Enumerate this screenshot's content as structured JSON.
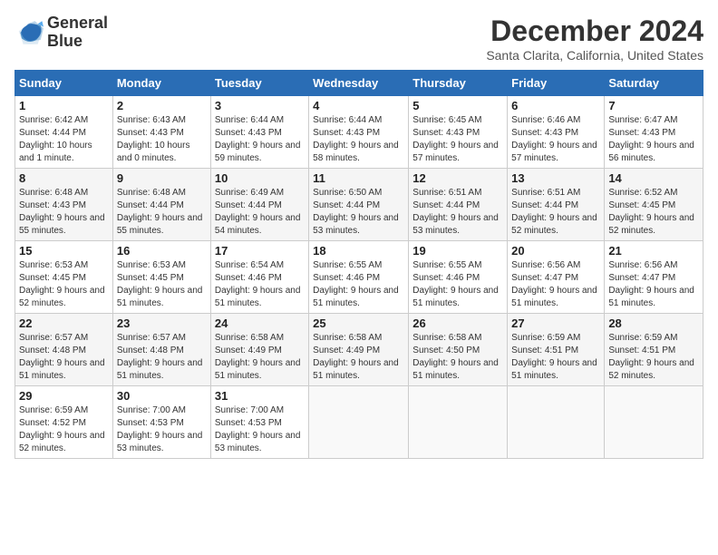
{
  "logo": {
    "line1": "General",
    "line2": "Blue"
  },
  "title": "December 2024",
  "location": "Santa Clarita, California, United States",
  "days_header": [
    "Sunday",
    "Monday",
    "Tuesday",
    "Wednesday",
    "Thursday",
    "Friday",
    "Saturday"
  ],
  "weeks": [
    [
      {
        "day": "1",
        "sun": "Sunrise: 6:42 AM",
        "set": "Sunset: 4:44 PM",
        "day_text": "Daylight: 10 hours and 1 minute."
      },
      {
        "day": "2",
        "sun": "Sunrise: 6:43 AM",
        "set": "Sunset: 4:43 PM",
        "day_text": "Daylight: 10 hours and 0 minutes."
      },
      {
        "day": "3",
        "sun": "Sunrise: 6:44 AM",
        "set": "Sunset: 4:43 PM",
        "day_text": "Daylight: 9 hours and 59 minutes."
      },
      {
        "day": "4",
        "sun": "Sunrise: 6:44 AM",
        "set": "Sunset: 4:43 PM",
        "day_text": "Daylight: 9 hours and 58 minutes."
      },
      {
        "day": "5",
        "sun": "Sunrise: 6:45 AM",
        "set": "Sunset: 4:43 PM",
        "day_text": "Daylight: 9 hours and 57 minutes."
      },
      {
        "day": "6",
        "sun": "Sunrise: 6:46 AM",
        "set": "Sunset: 4:43 PM",
        "day_text": "Daylight: 9 hours and 57 minutes."
      },
      {
        "day": "7",
        "sun": "Sunrise: 6:47 AM",
        "set": "Sunset: 4:43 PM",
        "day_text": "Daylight: 9 hours and 56 minutes."
      }
    ],
    [
      {
        "day": "8",
        "sun": "Sunrise: 6:48 AM",
        "set": "Sunset: 4:43 PM",
        "day_text": "Daylight: 9 hours and 55 minutes."
      },
      {
        "day": "9",
        "sun": "Sunrise: 6:48 AM",
        "set": "Sunset: 4:44 PM",
        "day_text": "Daylight: 9 hours and 55 minutes."
      },
      {
        "day": "10",
        "sun": "Sunrise: 6:49 AM",
        "set": "Sunset: 4:44 PM",
        "day_text": "Daylight: 9 hours and 54 minutes."
      },
      {
        "day": "11",
        "sun": "Sunrise: 6:50 AM",
        "set": "Sunset: 4:44 PM",
        "day_text": "Daylight: 9 hours and 53 minutes."
      },
      {
        "day": "12",
        "sun": "Sunrise: 6:51 AM",
        "set": "Sunset: 4:44 PM",
        "day_text": "Daylight: 9 hours and 53 minutes."
      },
      {
        "day": "13",
        "sun": "Sunrise: 6:51 AM",
        "set": "Sunset: 4:44 PM",
        "day_text": "Daylight: 9 hours and 52 minutes."
      },
      {
        "day": "14",
        "sun": "Sunrise: 6:52 AM",
        "set": "Sunset: 4:45 PM",
        "day_text": "Daylight: 9 hours and 52 minutes."
      }
    ],
    [
      {
        "day": "15",
        "sun": "Sunrise: 6:53 AM",
        "set": "Sunset: 4:45 PM",
        "day_text": "Daylight: 9 hours and 52 minutes."
      },
      {
        "day": "16",
        "sun": "Sunrise: 6:53 AM",
        "set": "Sunset: 4:45 PM",
        "day_text": "Daylight: 9 hours and 51 minutes."
      },
      {
        "day": "17",
        "sun": "Sunrise: 6:54 AM",
        "set": "Sunset: 4:46 PM",
        "day_text": "Daylight: 9 hours and 51 minutes."
      },
      {
        "day": "18",
        "sun": "Sunrise: 6:55 AM",
        "set": "Sunset: 4:46 PM",
        "day_text": "Daylight: 9 hours and 51 minutes."
      },
      {
        "day": "19",
        "sun": "Sunrise: 6:55 AM",
        "set": "Sunset: 4:46 PM",
        "day_text": "Daylight: 9 hours and 51 minutes."
      },
      {
        "day": "20",
        "sun": "Sunrise: 6:56 AM",
        "set": "Sunset: 4:47 PM",
        "day_text": "Daylight: 9 hours and 51 minutes."
      },
      {
        "day": "21",
        "sun": "Sunrise: 6:56 AM",
        "set": "Sunset: 4:47 PM",
        "day_text": "Daylight: 9 hours and 51 minutes."
      }
    ],
    [
      {
        "day": "22",
        "sun": "Sunrise: 6:57 AM",
        "set": "Sunset: 4:48 PM",
        "day_text": "Daylight: 9 hours and 51 minutes."
      },
      {
        "day": "23",
        "sun": "Sunrise: 6:57 AM",
        "set": "Sunset: 4:48 PM",
        "day_text": "Daylight: 9 hours and 51 minutes."
      },
      {
        "day": "24",
        "sun": "Sunrise: 6:58 AM",
        "set": "Sunset: 4:49 PM",
        "day_text": "Daylight: 9 hours and 51 minutes."
      },
      {
        "day": "25",
        "sun": "Sunrise: 6:58 AM",
        "set": "Sunset: 4:49 PM",
        "day_text": "Daylight: 9 hours and 51 minutes."
      },
      {
        "day": "26",
        "sun": "Sunrise: 6:58 AM",
        "set": "Sunset: 4:50 PM",
        "day_text": "Daylight: 9 hours and 51 minutes."
      },
      {
        "day": "27",
        "sun": "Sunrise: 6:59 AM",
        "set": "Sunset: 4:51 PM",
        "day_text": "Daylight: 9 hours and 51 minutes."
      },
      {
        "day": "28",
        "sun": "Sunrise: 6:59 AM",
        "set": "Sunset: 4:51 PM",
        "day_text": "Daylight: 9 hours and 52 minutes."
      }
    ],
    [
      {
        "day": "29",
        "sun": "Sunrise: 6:59 AM",
        "set": "Sunset: 4:52 PM",
        "day_text": "Daylight: 9 hours and 52 minutes."
      },
      {
        "day": "30",
        "sun": "Sunrise: 7:00 AM",
        "set": "Sunset: 4:53 PM",
        "day_text": "Daylight: 9 hours and 53 minutes."
      },
      {
        "day": "31",
        "sun": "Sunrise: 7:00 AM",
        "set": "Sunset: 4:53 PM",
        "day_text": "Daylight: 9 hours and 53 minutes."
      },
      null,
      null,
      null,
      null
    ]
  ]
}
